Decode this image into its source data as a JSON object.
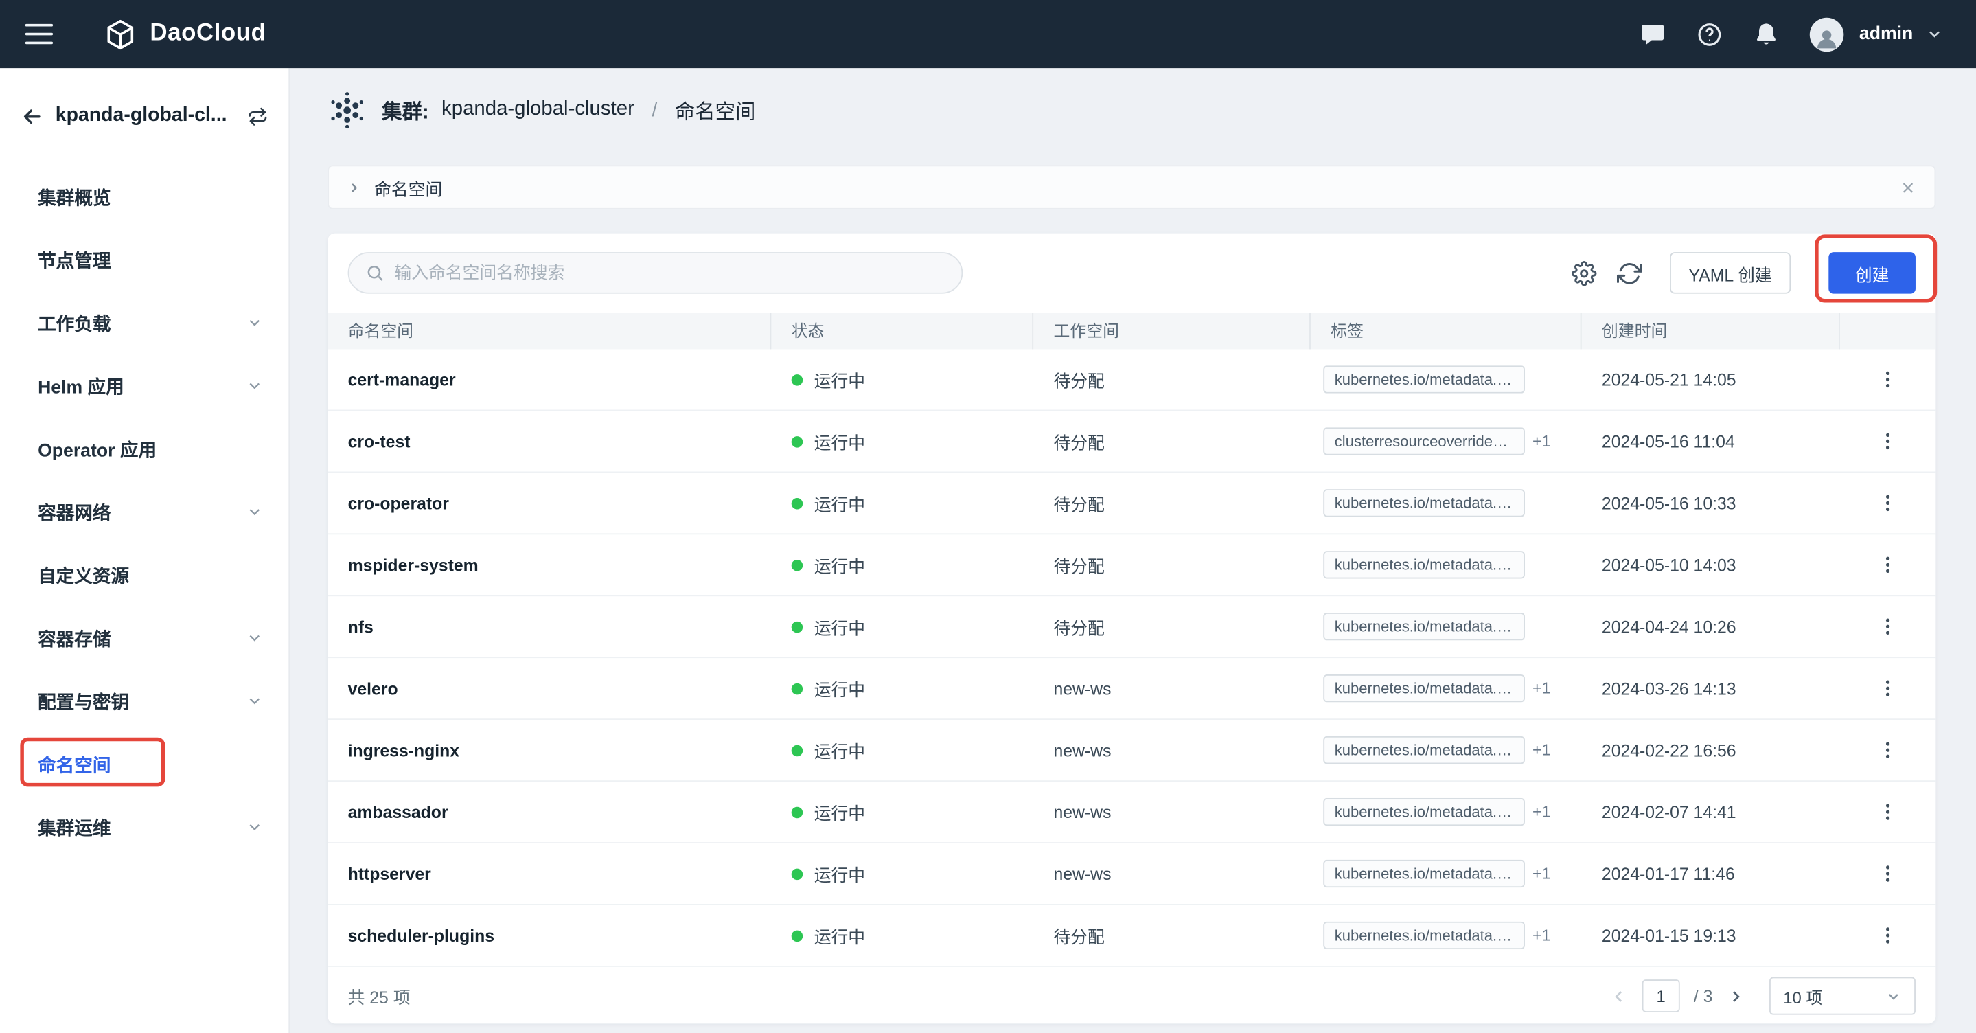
{
  "topbar": {
    "brand": "DaoCloud",
    "user": "admin"
  },
  "sidebar": {
    "cluster_name": "kpanda-global-cl...",
    "items": [
      {
        "label": "集群概览"
      },
      {
        "label": "节点管理"
      },
      {
        "label": "工作负载"
      },
      {
        "label": "Helm 应用"
      },
      {
        "label": "Operator 应用"
      },
      {
        "label": "容器网络"
      },
      {
        "label": "自定义资源"
      },
      {
        "label": "容器存储"
      },
      {
        "label": "配置与密钥"
      },
      {
        "label": "命名空间"
      },
      {
        "label": "集群运维"
      }
    ]
  },
  "header": {
    "prefix": "集群:",
    "cluster": "kpanda-global-cluster",
    "separator": "/",
    "current": "命名空间"
  },
  "tabbar": {
    "label": "命名空间"
  },
  "toolbar": {
    "search_placeholder": "输入命名空间名称搜索",
    "yaml_create_label": "YAML 创建",
    "create_label": "创建"
  },
  "table": {
    "columns": [
      "命名空间",
      "状态",
      "工作空间",
      "标签",
      "创建时间"
    ],
    "rows": [
      {
        "name": "cert-manager",
        "status": "运行中",
        "workspace": "待分配",
        "label": "kubernetes.io/metadata.nam...",
        "more": "",
        "created": "2024-05-21 14:05"
      },
      {
        "name": "cro-test",
        "status": "运行中",
        "workspace": "待分配",
        "label": "clusterresourceoverrides....",
        "more": "+1",
        "created": "2024-05-16 11:04"
      },
      {
        "name": "cro-operator",
        "status": "运行中",
        "workspace": "待分配",
        "label": "kubernetes.io/metadata.nam...",
        "more": "",
        "created": "2024-05-16 10:33"
      },
      {
        "name": "mspider-system",
        "status": "运行中",
        "workspace": "待分配",
        "label": "kubernetes.io/metadata.nam...",
        "more": "",
        "created": "2024-05-10 14:03"
      },
      {
        "name": "nfs",
        "status": "运行中",
        "workspace": "待分配",
        "label": "kubernetes.io/metadata.nam...",
        "more": "",
        "created": "2024-04-24 10:26"
      },
      {
        "name": "velero",
        "status": "运行中",
        "workspace": "new-ws",
        "label": "kubernetes.io/metadata.n...",
        "more": "+1",
        "created": "2024-03-26 14:13"
      },
      {
        "name": "ingress-nginx",
        "status": "运行中",
        "workspace": "new-ws",
        "label": "kubernetes.io/metadata.n...",
        "more": "+1",
        "created": "2024-02-22 16:56"
      },
      {
        "name": "ambassador",
        "status": "运行中",
        "workspace": "new-ws",
        "label": "kubernetes.io/metadata.n...",
        "more": "+1",
        "created": "2024-02-07 14:41"
      },
      {
        "name": "httpserver",
        "status": "运行中",
        "workspace": "new-ws",
        "label": "kubernetes.io/metadata.n...",
        "more": "+1",
        "created": "2024-01-17 11:46"
      },
      {
        "name": "scheduler-plugins",
        "status": "运行中",
        "workspace": "待分配",
        "label": "kubernetes.io/metadata.n...",
        "more": "+1",
        "created": "2024-01-15 19:13"
      }
    ]
  },
  "footer": {
    "total": "共 25 项",
    "page": "1",
    "page_total": "/ 3",
    "page_size": "10 项"
  },
  "colors": {
    "topbar_bg": "#1b2938",
    "primary_blue": "#2e63ea",
    "active_link": "#3264e8",
    "status_green": "#2dc653",
    "annotation_red": "#e5463b"
  }
}
